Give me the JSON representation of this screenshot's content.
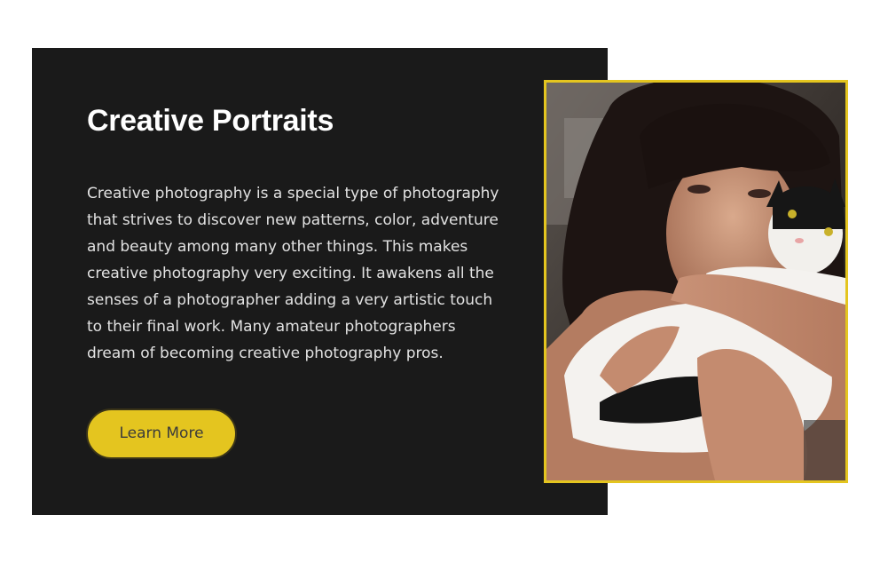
{
  "section": {
    "title": "Creative Portraits",
    "body_lines": [
      "Creative photography is a special type of photography",
      "that strives to discover new patterns, color, adventure",
      "and beauty among many other things. This makes",
      "creative photography very exciting. It awakens all the",
      "senses of a photographer adding a very artistic touch",
      "to their final work. Many amateur photographers",
      "dream of becoming creative photography pros."
    ],
    "button_label": "Learn More"
  },
  "colors": {
    "card_background": "#1a1a1a",
    "accent_yellow": "#e4c51f",
    "title_text": "#ffffff",
    "body_text": "#e2e2e2"
  },
  "image": {
    "subject": "portrait of a woman with dark hair and bangs holding a black-and-white cat"
  }
}
